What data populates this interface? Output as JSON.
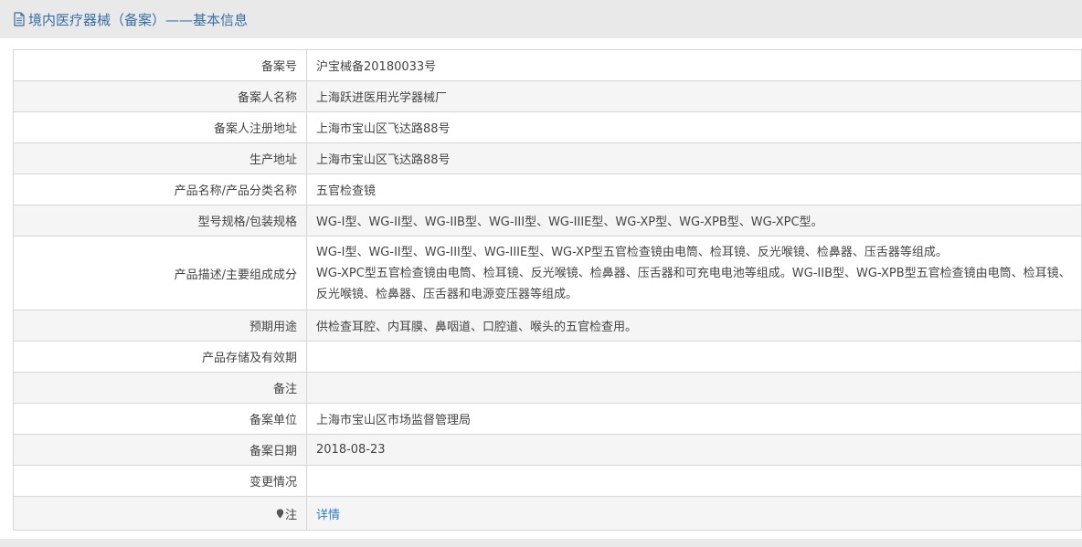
{
  "header": {
    "title": "境内医疗器械（备案）——基本信息"
  },
  "rows": [
    {
      "label": "备案号",
      "value": "沪宝械备20180033号"
    },
    {
      "label": "备案人名称",
      "value": "上海跃进医用光学器械厂"
    },
    {
      "label": "备案人注册地址",
      "value": "上海市宝山区飞达路88号"
    },
    {
      "label": "生产地址",
      "value": "上海市宝山区飞达路88号"
    },
    {
      "label": "产品名称/产品分类名称",
      "value": "五官检查镜"
    },
    {
      "label": "型号规格/包装规格",
      "value": "WG-I型、WG-II型、WG-IIB型、WG-III型、WG-IIIE型、WG-XP型、WG-XPB型、WG-XPC型。"
    },
    {
      "label": "产品描述/主要组成成分",
      "line1": "WG-I型、WG-II型、WG-III型、WG-IIIE型、WG-XP型五官检查镜由电筒、检耳镜、反光喉镜、检鼻器、压舌器等组成。",
      "line2": "WG-XPC型五官检查镜由电筒、检耳镜、反光喉镜、检鼻器、压舌器和可充电电池等组成。WG-IIB型、WG-XPB型五官检查镜由电筒、检耳镜、反光喉镜、检鼻器、压舌器和电源变压器等组成。"
    },
    {
      "label": "预期用途",
      "value": "供检查耳腔、内耳膜、鼻咽道、口腔道、喉头的五官检查用。"
    },
    {
      "label": "产品存储及有效期",
      "value": ""
    },
    {
      "label": "备注",
      "value": ""
    },
    {
      "label": "备案单位",
      "value": "上海市宝山区市场监督管理局"
    },
    {
      "label": "备案日期",
      "value": "2018-08-23"
    },
    {
      "label": "变更情况",
      "value": ""
    },
    {
      "label": "注",
      "value": "详情"
    }
  ],
  "icons": {
    "header": "document-icon",
    "note": "map-pin-icon"
  },
  "colors": {
    "accent": "#3a6ea5",
    "link": "#2e7bcf"
  }
}
